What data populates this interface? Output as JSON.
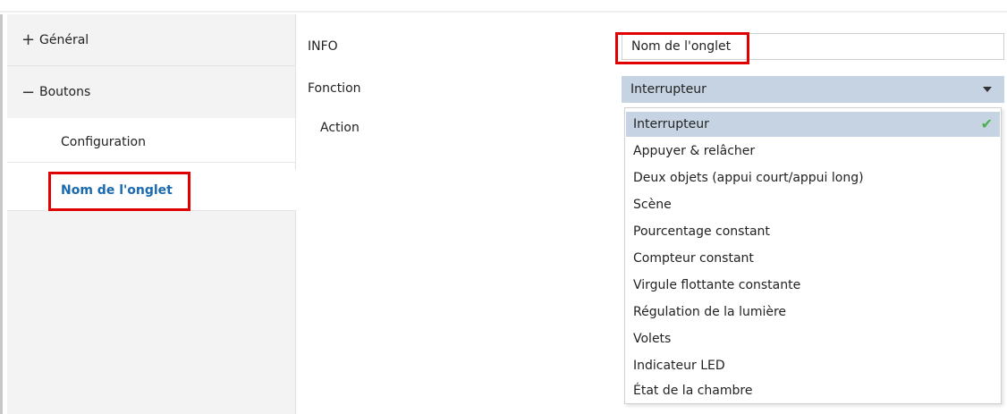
{
  "sidebar": {
    "general": {
      "sign": "+",
      "label": "Général"
    },
    "boutons": {
      "sign": "−",
      "label": "Boutons"
    },
    "sub_items": [
      {
        "label": "Configuration"
      },
      {
        "label": "Nom de l'onglet"
      }
    ]
  },
  "params": {
    "info_label": "INFO",
    "info_value": "Nom de l'onglet",
    "fonction_label": "Fonction",
    "fonction_selected": "Interrupteur",
    "action_label": "Action"
  },
  "dropdown": {
    "options": [
      "Interrupteur",
      "Appuyer & relâcher",
      "Deux objets (appui court/appui long)",
      "Scène",
      "Pourcentage constant",
      "Compteur constant",
      "Virgule flottante constante",
      "Régulation de la lumière",
      "Volets",
      "Indicateur LED",
      "État de la chambre"
    ],
    "selected_index": 0,
    "check_icon": "✔"
  },
  "colors": {
    "highlight": "#e00000",
    "select_bg": "#c5d3e3",
    "selected_text": "#1a6ab0",
    "check": "#4caf50"
  }
}
